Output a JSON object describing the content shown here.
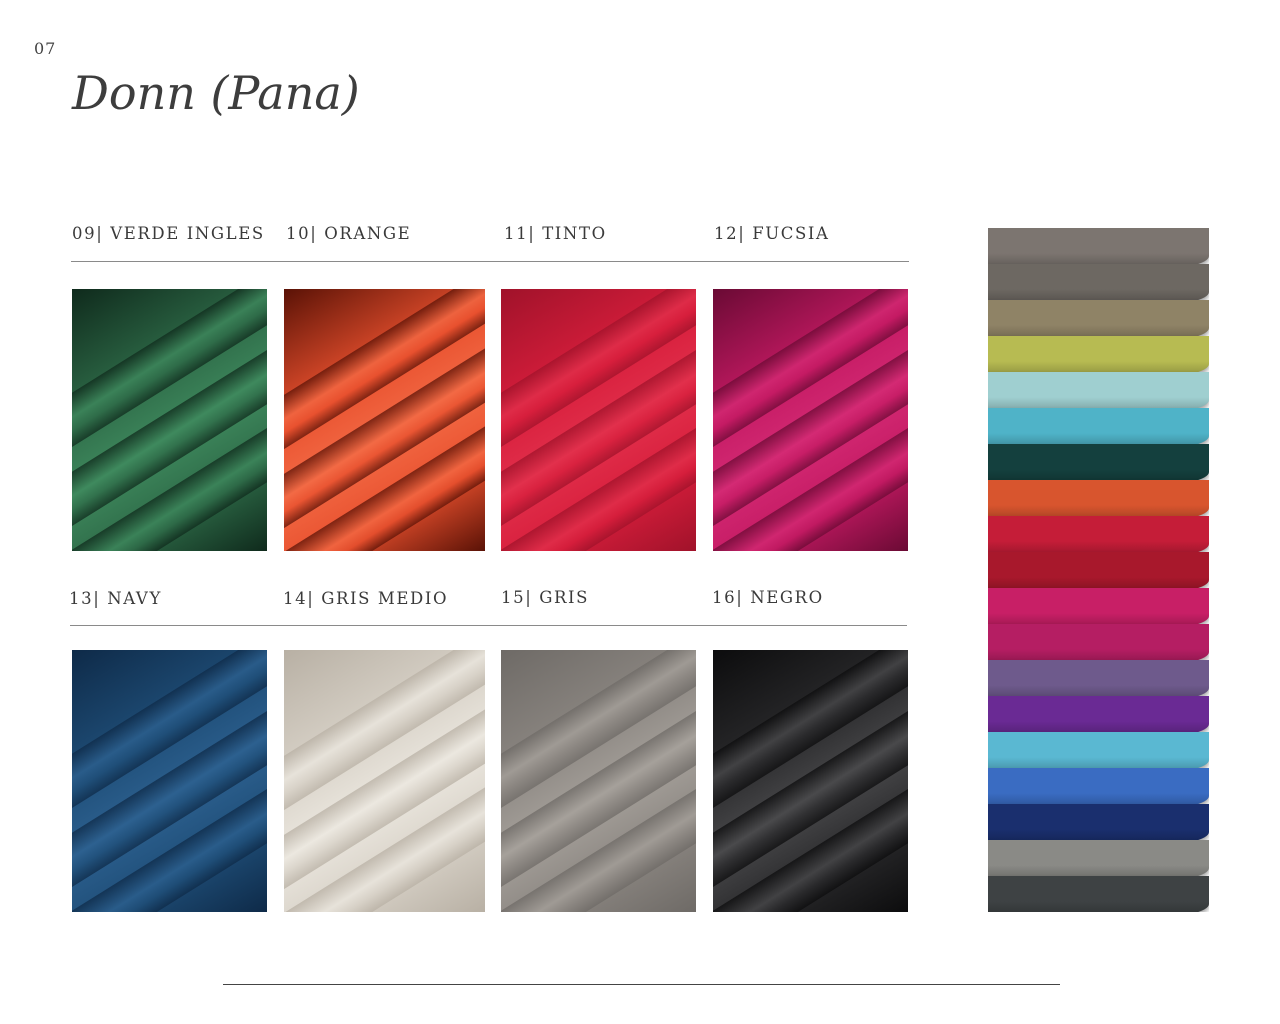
{
  "page": {
    "number": "07",
    "title": "Donn (Pana)"
  },
  "swatches": [
    {
      "label": "09| VERDE INGLES",
      "color": "#2e6b48",
      "dark": "#0f2a1c",
      "light": "#3f8a5e"
    },
    {
      "label": "10| ORANGE",
      "color": "#e8502e",
      "dark": "#5a1206",
      "light": "#f36a45"
    },
    {
      "label": "11| TINTO",
      "color": "#d71e3c",
      "dark": "#a0122a",
      "light": "#e2304c"
    },
    {
      "label": "12| FUCSIA",
      "color": "#c41a63",
      "dark": "#6a0a34",
      "light": "#d42a74"
    },
    {
      "label": "13| NAVY",
      "color": "#1f4e78",
      "dark": "#0e2a48",
      "light": "#2d6190"
    },
    {
      "label": "14| GRIS MEDIO",
      "color": "#d8d2c8",
      "dark": "#b8b0a4",
      "light": "#ece8e0"
    },
    {
      "label": "15| GRIS",
      "color": "#8c8782",
      "dark": "#6e6a66",
      "light": "#a6a19b"
    },
    {
      "label": "16| NEGRO",
      "color": "#2a2a2c",
      "dark": "#0c0c0d",
      "light": "#4a4a4c"
    }
  ],
  "stack_colors": [
    "#7c7570",
    "#6d6862",
    "#8f8366",
    "#b7bb52",
    "#9fcfd0",
    "#4fb3c8",
    "#14403e",
    "#d8552e",
    "#c51d38",
    "#a8182c",
    "#c81f66",
    "#b51e63",
    "#6e5a8c",
    "#6a2a94",
    "#5ab8d2",
    "#3a6cc2",
    "#1a2f6e",
    "#8a8a86",
    "#3e4244"
  ]
}
